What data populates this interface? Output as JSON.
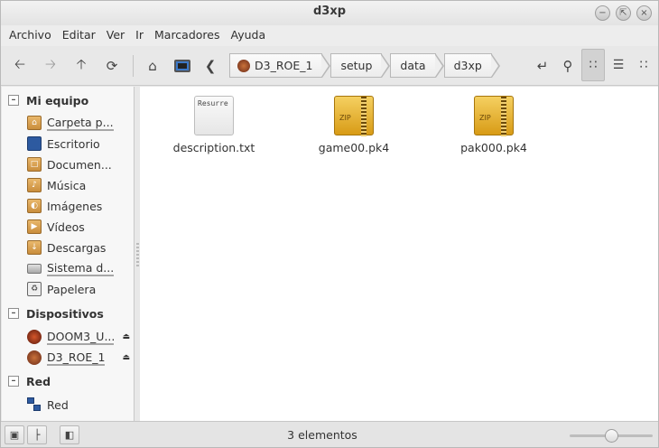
{
  "window": {
    "title": "d3xp"
  },
  "titlebar_buttons": [
    "minimize-icon",
    "maximize-icon",
    "close-icon"
  ],
  "menu": [
    "Archivo",
    "Editar",
    "Ver",
    "Ir",
    "Marcadores",
    "Ayuda"
  ],
  "breadcrumb": [
    "D3_ROE_1",
    "setup",
    "data",
    "d3xp"
  ],
  "sidebar": {
    "sections": [
      {
        "title": "Mi equipo",
        "items": [
          {
            "label": "Carpeta p...",
            "icon": "home-folder-icon"
          },
          {
            "label": "Escritorio",
            "icon": "desktop-icon"
          },
          {
            "label": "Documen...",
            "icon": "documents-folder-icon"
          },
          {
            "label": "Música",
            "icon": "music-folder-icon"
          },
          {
            "label": "Imágenes",
            "icon": "pictures-folder-icon"
          },
          {
            "label": "Vídeos",
            "icon": "videos-folder-icon"
          },
          {
            "label": "Descargas",
            "icon": "downloads-folder-icon"
          },
          {
            "label": "Sistema d...",
            "icon": "filesystem-icon"
          },
          {
            "label": "Papelera",
            "icon": "trash-icon"
          }
        ]
      },
      {
        "title": "Dispositivos",
        "items": [
          {
            "label": "DOOM3_U...",
            "icon": "disc-icon"
          },
          {
            "label": "D3_ROE_1",
            "icon": "disc-icon"
          }
        ]
      },
      {
        "title": "Red",
        "items": [
          {
            "label": "Red",
            "icon": "network-icon"
          }
        ]
      }
    ]
  },
  "files": [
    {
      "name": "description.txt",
      "icon": "text-file-icon",
      "preview": "Resurre"
    },
    {
      "name": "game00.pk4",
      "icon": "zip-archive-icon",
      "badge": "ZIP"
    },
    {
      "name": "pak000.pk4",
      "icon": "zip-archive-icon",
      "badge": "ZIP"
    }
  ],
  "status": {
    "text": "3 elementos",
    "zoom_level": 0.5
  }
}
